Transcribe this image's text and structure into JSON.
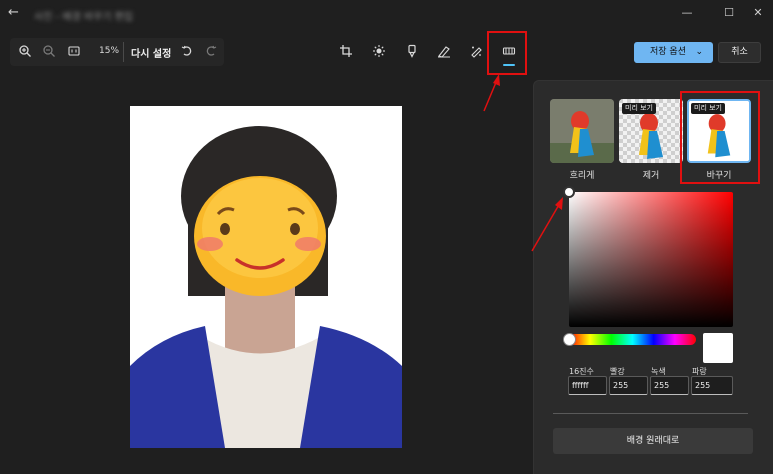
{
  "window": {
    "title": "사진 - 배경 바꾸기 편집",
    "minimize_icon": "minimize-icon",
    "maximize_icon": "maximize-icon",
    "close_icon": "close-icon"
  },
  "toolbar": {
    "zoom_level": "15%",
    "reset_label": "다시 설정",
    "tools": [
      "crop-icon",
      "brightness-icon",
      "markup-icon",
      "erase-icon",
      "retouch-icon",
      "background-icon"
    ],
    "active_tool": "background-icon"
  },
  "actions": {
    "save_label": "저장 옵션",
    "cancel_label": "취소"
  },
  "panel": {
    "options": [
      {
        "label": "흐리게"
      },
      {
        "label": "제거",
        "badge": "미리 보기"
      },
      {
        "label": "바꾸기",
        "badge": "미리 보기",
        "selected": true
      }
    ],
    "color": {
      "hex_label": "16진수",
      "hex_value": "ffffff",
      "red_label": "빨강",
      "red_value": "255",
      "green_label": "녹색",
      "green_value": "255",
      "blue_label": "파랑",
      "blue_value": "255",
      "swatch_color": "#ffffff"
    },
    "restore_label": "배경 원래대로"
  },
  "colors": {
    "accent": "#6fb6f2",
    "annotation_red": "#e01010",
    "active_underline": "#4fc3f7"
  }
}
